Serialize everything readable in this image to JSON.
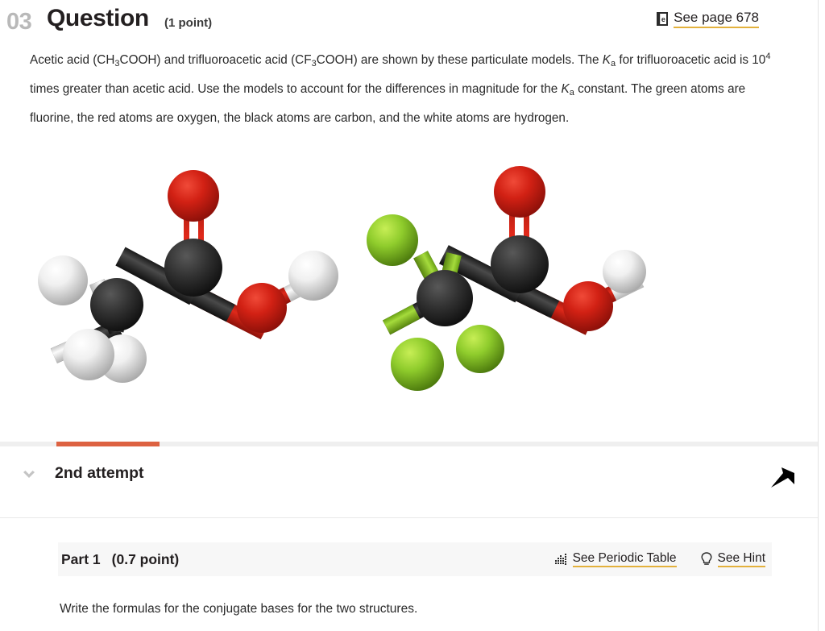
{
  "header": {
    "number": "03",
    "title": "Question",
    "points": "(1 point)",
    "see_page_label": "See page 678",
    "book_icon": "ebook-icon"
  },
  "question": {
    "text_runs": [
      "Acetic acid (CH",
      "3",
      "COOH) and trifluoroacetic acid (CF",
      "3",
      "COOH) are shown by these particulate models. The ",
      "K",
      "a",
      " for trifluoroacetic acid is 10",
      "4",
      " times greater than acetic acid. Use the models to account for the differences in magnitude for the ",
      "K",
      "a",
      " constant. The green atoms are fluorine, the red atoms are oxygen, the black atoms are carbon, and the white atoms are hydrogen."
    ],
    "plain_text": "Acetic acid (CH3COOH) and trifluoroacetic acid (CF3COOH) are shown by these particulate models. The Ka for trifluoroacetic acid is 10^4 times greater than acetic acid. Use the models to account for the differences in magnitude for the Ka constant. The green atoms are fluorine, the red atoms are oxygen, the black atoms are carbon, and the white atoms are hydrogen."
  },
  "figure": {
    "name": "particulate-models",
    "molecules": [
      {
        "name": "acetic-acid",
        "formula": "CH3COOH"
      },
      {
        "name": "trifluoroacetic-acid",
        "formula": "CF3COOH"
      }
    ],
    "atom_colors": {
      "oxygen": "#cc1e12",
      "carbon": "#2b2b2b",
      "hydrogen": "#e8e8e8",
      "fluorine": "#8ecc2b"
    }
  },
  "attempt": {
    "label": "2nd attempt",
    "progress_color": "#dd6241",
    "chevron_icon": "chevron-down-icon",
    "pin_icon": "pin-icon"
  },
  "part": {
    "title": "Part 1",
    "points": "(0.7 point)",
    "periodic_table_label": "See Periodic Table",
    "periodic_table_icon": "periodic-table-icon",
    "hint_label": "See Hint",
    "hint_icon": "lightbulb-icon",
    "prompt": "Write the formulas for the conjugate bases for the two structures."
  }
}
